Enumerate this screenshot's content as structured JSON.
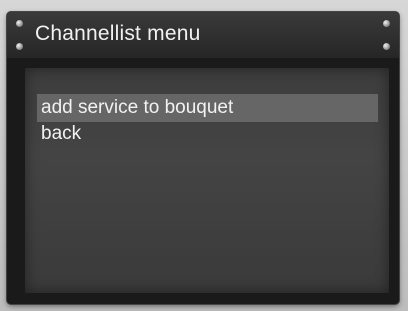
{
  "window": {
    "title": "Channellist menu"
  },
  "menu": {
    "items": [
      {
        "label": "add service to bouquet",
        "selected": true
      },
      {
        "label": "back",
        "selected": false
      }
    ]
  },
  "colors": {
    "window_bg": "#1a1a1a",
    "title_bar": "#2f2f2f",
    "panel_bg": "#404040",
    "selection": "#666666",
    "text": "#f2f2f2"
  }
}
